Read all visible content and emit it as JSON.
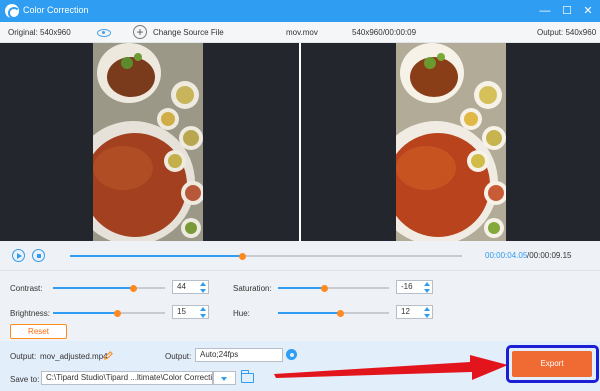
{
  "window": {
    "title": "Color Correction",
    "controls": [
      "minimize-icon",
      "maximize-icon",
      "close-icon"
    ]
  },
  "infobar": {
    "original_label": "Original: 540x960",
    "change_source_label": "Change Source File",
    "filename": "mov.mov",
    "meta": "540x960/00:00:09",
    "output_label": "Output: 540x960"
  },
  "playback": {
    "current_time": "00:00:04.05",
    "total_time": "/00:00:09.15",
    "progress": 0.44
  },
  "adjust": {
    "contrast": {
      "label": "Contrast:",
      "value": "44",
      "level": 0.72
    },
    "brightness": {
      "label": "Brightness:",
      "value": "15",
      "level": 0.58
    },
    "saturation": {
      "label": "Saturation:",
      "value": "-16",
      "level": 0.42
    },
    "hue": {
      "label": "Hue:",
      "value": "12",
      "level": 0.56
    },
    "reset_label": "Reset"
  },
  "bottom": {
    "output_file_label": "Output:",
    "output_file_name": "mov_adjusted.mp4",
    "output_format_label": "Output:",
    "output_format_value": "Auto;24fps",
    "save_to_label": "Save to:",
    "save_to_path": "C:\\Tipard Studio\\Tipard ...ltimate\\Color Correction",
    "export_label": "Export"
  },
  "colors": {
    "accent": "#2e9df2",
    "thumb": "#ff8a1f",
    "export": "#f06a34",
    "highlight": "#1a1fd6",
    "arrow": "#e3151c"
  }
}
